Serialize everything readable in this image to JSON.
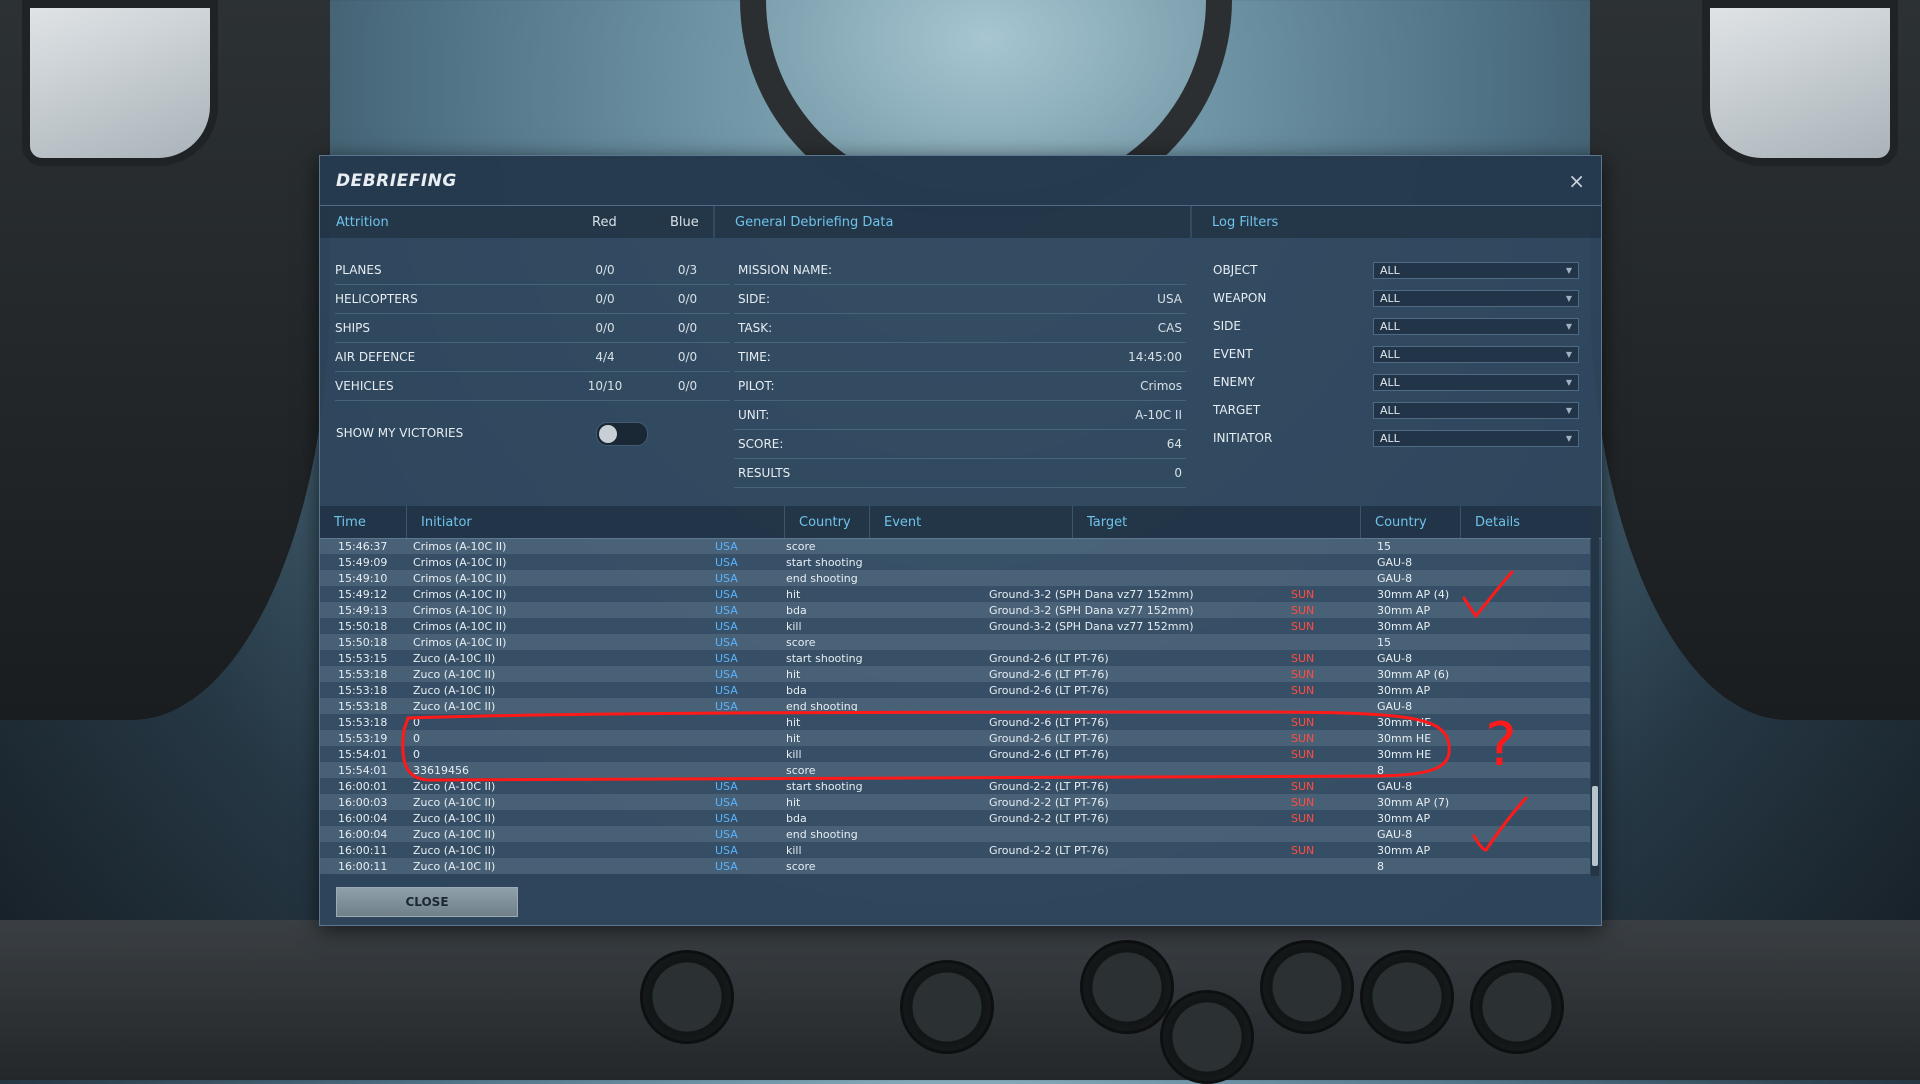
{
  "dialog": {
    "title": "DEBRIEFING",
    "close_glyph": "×"
  },
  "attrition": {
    "header": "Attrition",
    "col_red": "Red",
    "col_blue": "Blue",
    "rows": [
      {
        "label": "PLANES",
        "red": "0/0",
        "blue": "0/3"
      },
      {
        "label": "HELICOPTERS",
        "red": "0/0",
        "blue": "0/0"
      },
      {
        "label": "SHIPS",
        "red": "0/0",
        "blue": "0/0"
      },
      {
        "label": "AIR DEFENCE",
        "red": "4/4",
        "blue": "0/0"
      },
      {
        "label": "VEHICLES",
        "red": "10/10",
        "blue": "0/0"
      }
    ],
    "show_victories_label": "SHOW MY VICTORIES",
    "show_victories_on": false
  },
  "general": {
    "header": "General Debriefing Data",
    "rows": [
      {
        "label": "MISSION NAME:",
        "value": ""
      },
      {
        "label": "SIDE:",
        "value": "USA"
      },
      {
        "label": "TASK:",
        "value": "CAS"
      },
      {
        "label": "TIME:",
        "value": "14:45:00"
      },
      {
        "label": "PILOT:",
        "value": "Crimos"
      },
      {
        "label": "UNIT:",
        "value": "A-10C II"
      },
      {
        "label": "SCORE:",
        "value": "64"
      },
      {
        "label": "RESULTS",
        "value": "0"
      }
    ]
  },
  "filters": {
    "header": "Log Filters",
    "rows": [
      {
        "label": "OBJECT",
        "value": "ALL"
      },
      {
        "label": "WEAPON",
        "value": "ALL"
      },
      {
        "label": "SIDE",
        "value": "ALL"
      },
      {
        "label": "EVENT",
        "value": "ALL"
      },
      {
        "label": "ENEMY",
        "value": "ALL"
      },
      {
        "label": "TARGET",
        "value": "ALL"
      },
      {
        "label": "INITIATOR",
        "value": "ALL"
      }
    ]
  },
  "log": {
    "headers": {
      "time": "Time",
      "initiator": "Initiator",
      "country": "Country",
      "event": "Event",
      "target": "Target",
      "target_country": "Country",
      "details": "Details"
    },
    "rows": [
      {
        "time": "15:46:37",
        "initiator": "Crimos (A-10C II)",
        "country": "USA",
        "event": "score",
        "target": "",
        "tcountry": "",
        "details": "15"
      },
      {
        "time": "15:49:09",
        "initiator": "Crimos (A-10C II)",
        "country": "USA",
        "event": "start shooting",
        "target": "",
        "tcountry": "",
        "details": "GAU-8"
      },
      {
        "time": "15:49:10",
        "initiator": "Crimos (A-10C II)",
        "country": "USA",
        "event": "end shooting",
        "target": "",
        "tcountry": "",
        "details": "GAU-8"
      },
      {
        "time": "15:49:12",
        "initiator": "Crimos (A-10C II)",
        "country": "USA",
        "event": "hit",
        "target": "Ground-3-2 (SPH Dana vz77 152mm)",
        "tcountry": "SUN",
        "details": "30mm AP (4)"
      },
      {
        "time": "15:49:13",
        "initiator": "Crimos (A-10C II)",
        "country": "USA",
        "event": "bda",
        "target": "Ground-3-2 (SPH Dana vz77 152mm)",
        "tcountry": "SUN",
        "details": "30mm AP"
      },
      {
        "time": "15:50:18",
        "initiator": "Crimos (A-10C II)",
        "country": "USA",
        "event": "kill",
        "target": "Ground-3-2 (SPH Dana vz77 152mm)",
        "tcountry": "SUN",
        "details": "30mm AP"
      },
      {
        "time": "15:50:18",
        "initiator": "Crimos (A-10C II)",
        "country": "USA",
        "event": "score",
        "target": "",
        "tcountry": "",
        "details": "15"
      },
      {
        "time": "15:53:15",
        "initiator": "Zuco (A-10C II)",
        "country": "USA",
        "event": "start shooting",
        "target": "Ground-2-6 (LT PT-76)",
        "tcountry": "SUN",
        "details": "GAU-8"
      },
      {
        "time": "15:53:18",
        "initiator": "Zuco (A-10C II)",
        "country": "USA",
        "event": "hit",
        "target": "Ground-2-6 (LT PT-76)",
        "tcountry": "SUN",
        "details": "30mm AP (6)"
      },
      {
        "time": "15:53:18",
        "initiator": "Zuco (A-10C II)",
        "country": "USA",
        "event": "bda",
        "target": "Ground-2-6 (LT PT-76)",
        "tcountry": "SUN",
        "details": "30mm AP"
      },
      {
        "time": "15:53:18",
        "initiator": "Zuco (A-10C II)",
        "country": "USA",
        "event": "end shooting",
        "target": "",
        "tcountry": "",
        "details": "GAU-8"
      },
      {
        "time": "15:53:18",
        "initiator": "0",
        "country": "",
        "event": "hit",
        "target": "Ground-2-6 (LT PT-76)",
        "tcountry": "SUN",
        "details": "30mm HE"
      },
      {
        "time": "15:53:19",
        "initiator": "0",
        "country": "",
        "event": "hit",
        "target": "Ground-2-6 (LT PT-76)",
        "tcountry": "SUN",
        "details": "30mm HE"
      },
      {
        "time": "15:54:01",
        "initiator": "0",
        "country": "",
        "event": "kill",
        "target": "Ground-2-6 (LT PT-76)",
        "tcountry": "SUN",
        "details": "30mm HE"
      },
      {
        "time": "15:54:01",
        "initiator": "33619456",
        "country": "",
        "event": "score",
        "target": "",
        "tcountry": "",
        "details": "8"
      },
      {
        "time": "16:00:01",
        "initiator": "Zuco (A-10C II)",
        "country": "USA",
        "event": "start shooting",
        "target": "Ground-2-2 (LT PT-76)",
        "tcountry": "SUN",
        "details": "GAU-8"
      },
      {
        "time": "16:00:03",
        "initiator": "Zuco (A-10C II)",
        "country": "USA",
        "event": "hit",
        "target": "Ground-2-2 (LT PT-76)",
        "tcountry": "SUN",
        "details": "30mm AP (7)"
      },
      {
        "time": "16:00:04",
        "initiator": "Zuco (A-10C II)",
        "country": "USA",
        "event": "bda",
        "target": "Ground-2-2 (LT PT-76)",
        "tcountry": "SUN",
        "details": "30mm AP"
      },
      {
        "time": "16:00:04",
        "initiator": "Zuco (A-10C II)",
        "country": "USA",
        "event": "end shooting",
        "target": "",
        "tcountry": "",
        "details": "GAU-8"
      },
      {
        "time": "16:00:11",
        "initiator": "Zuco (A-10C II)",
        "country": "USA",
        "event": "kill",
        "target": "Ground-2-2 (LT PT-76)",
        "tcountry": "SUN",
        "details": "30mm AP"
      },
      {
        "time": "16:00:11",
        "initiator": "Zuco (A-10C II)",
        "country": "USA",
        "event": "score",
        "target": "",
        "tcountry": "",
        "details": "8"
      }
    ]
  },
  "close_button": "CLOSE",
  "annotation": {
    "question_mark": "?",
    "color": "#ff1a1a"
  },
  "colors": {
    "accent": "#6fc3ea",
    "usa": "#5ab4ff",
    "sun": "#ff4e3e"
  }
}
